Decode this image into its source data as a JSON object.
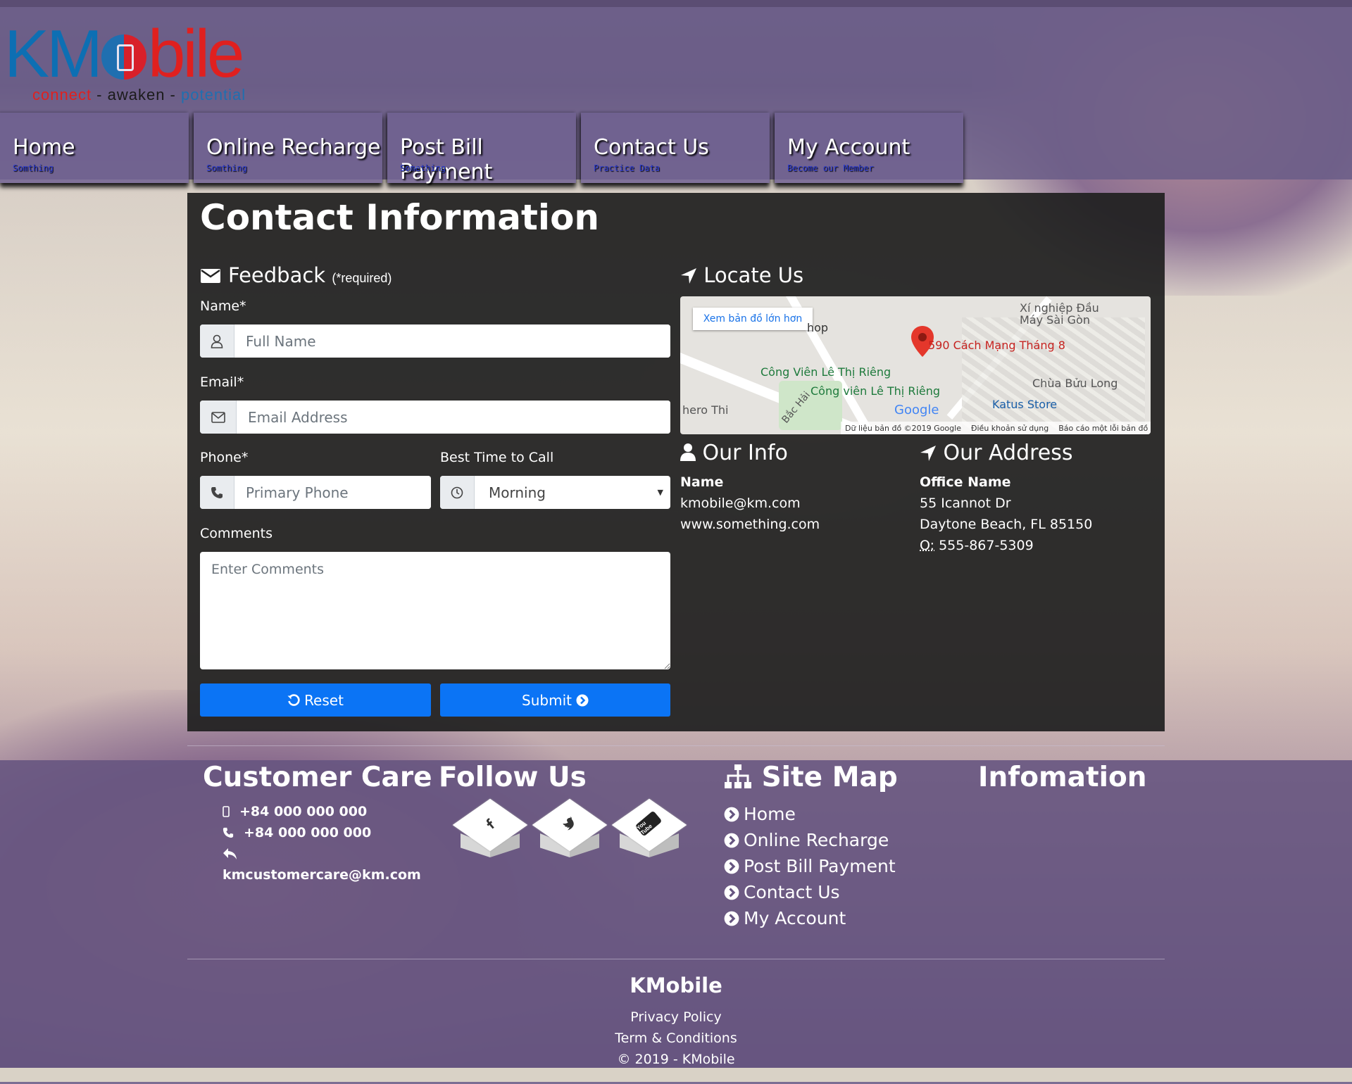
{
  "brand": {
    "logo_text_blue": "KM",
    "logo_text_red": "bile",
    "tagline_1": "connect",
    "tagline_2": " - awaken - ",
    "tagline_3": "potential",
    "colors": {
      "blue": "#0d6fb3",
      "red": "#e0201f",
      "accent_button": "#0b74f5"
    }
  },
  "nav": [
    {
      "title": "Home",
      "sub": "Somthing"
    },
    {
      "title": "Online Recharge",
      "sub": "Somthing"
    },
    {
      "title": "Post Bill Payment",
      "sub": "Something"
    },
    {
      "title": "Contact Us",
      "sub": "Practice Data"
    },
    {
      "title": "My Account",
      "sub": "Become our Member"
    }
  ],
  "contact": {
    "title": "Contact Information",
    "feedback": {
      "title": "Feedback",
      "required_note": "(*required)",
      "name_label": "Name*",
      "name_placeholder": "Full Name",
      "email_label": "Email*",
      "email_placeholder": "Email Address",
      "phone_label": "Phone*",
      "phone_placeholder": "Primary Phone",
      "time_label": "Best Time to Call",
      "time_value": "Morning",
      "comments_label": "Comments",
      "comments_placeholder": "Enter Comments",
      "reset_label": "Reset",
      "submit_label": "Submit"
    },
    "locate": {
      "title": "Locate Us",
      "larger_map": "Xem bản đồ lớn hơn",
      "pin_label": "590 Cách Mạng Tháng 8",
      "labels": {
        "factory": "Xí nghiệp Đầu Máy Sài Gòn",
        "park1": "Công Viên Lê Thị Riêng",
        "park2": "Công viên Lê Thị Riêng",
        "pagoda": "Chùa Bửu Long",
        "store": "Katus Store",
        "hero": "hero Thi",
        "street": "Bắc Hải",
        "shop": "hop",
        "google": "Google"
      },
      "footer": [
        "Dữ liệu bản đồ ©2019 Google",
        "Điều khoản sử dụng",
        "Báo cáo một lỗi bản đồ"
      ]
    },
    "our_info": {
      "title": "Our Info",
      "name": "Name",
      "email": "kmobile@km.com",
      "web": "www.something.com"
    },
    "our_address": {
      "title": "Our Address",
      "office": "Office Name",
      "street": "55 Icannot Dr",
      "city": "Daytone Beach, FL 85150",
      "phone_prefix": "O:",
      "phone": " 555-867-5309"
    }
  },
  "footer": {
    "customer_care": {
      "title": "Customer Care",
      "mobile": "+84 000 000 000",
      "phone": "+84 000 000 000",
      "email": "kmcustomercare@km.com"
    },
    "follow": {
      "title": "Follow Us",
      "youtube_text": "You Tube"
    },
    "sitemap": {
      "title": "Site Map",
      "links": [
        "Home",
        "Online Recharge",
        "Post Bill Payment",
        "Contact Us",
        "My Account"
      ]
    },
    "information": {
      "title": "Infomation"
    },
    "brand": "KMobile",
    "privacy": "Privacy Policy",
    "terms": "Term & Conditions",
    "copyright": "© 2019 - KMobile"
  }
}
